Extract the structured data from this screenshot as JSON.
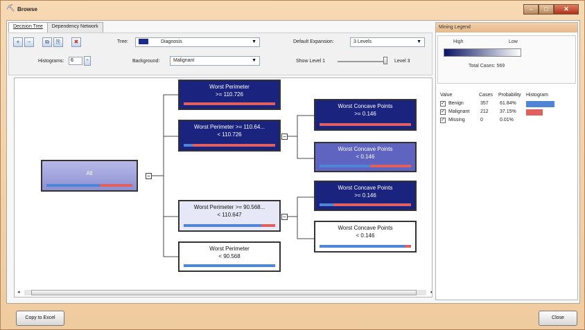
{
  "window": {
    "title": "Browse"
  },
  "tabs": [
    {
      "label": "Decision Tree"
    },
    {
      "label": "Dependency Network"
    }
  ],
  "toolbar": {
    "tree_label": "Tree:",
    "tree_value": "Diagnosis",
    "default_expansion_label": "Default Expansion:",
    "default_expansion_value": "3 Levels",
    "histograms_label": "Histograms:",
    "histograms_value": "6",
    "background_label": "Background:",
    "background_value": "Malignant",
    "show_level_label": "Show Level 1",
    "show_level_end": "Level 3"
  },
  "tree": {
    "colors": {
      "dark": "#1a237e",
      "mid": "#5f64c0",
      "light": "#e7e8f7",
      "benign": "#4f85d6",
      "malignant": "#e0605f"
    },
    "nodes": [
      {
        "id": "all",
        "line1": "All",
        "line2": "",
        "shade": "root",
        "benign": 0.62,
        "malignant": 0.38
      },
      {
        "id": "n1",
        "line1": "Worst Perimeter",
        "line2": ">= 110.726",
        "shade": "dark",
        "benign": 0.0,
        "malignant": 1.0
      },
      {
        "id": "n2",
        "line1": "Worst Perimeter >= 110.64...",
        "line2": "< 110.726",
        "shade": "dark",
        "benign": 0.1,
        "malignant": 0.9
      },
      {
        "id": "n3",
        "line1": "Worst Perimeter >= 90.568...",
        "line2": "< 110.647",
        "shade": "light",
        "benign": 0.85,
        "malignant": 0.15
      },
      {
        "id": "n4",
        "line1": "Worst Perimeter",
        "line2": "< 90.568",
        "shade": "white",
        "benign": 1.0,
        "malignant": 0.0
      },
      {
        "id": "n5",
        "line1": "Worst Concave Points",
        "line2": ">= 0.146",
        "shade": "dark",
        "benign": 0.0,
        "malignant": 1.0
      },
      {
        "id": "n6",
        "line1": "Worst Concave Points",
        "line2": "< 0.146",
        "shade": "mid",
        "benign": 0.55,
        "malignant": 0.45
      },
      {
        "id": "n7",
        "line1": "Worst Concave Points",
        "line2": ">= 0.146",
        "shade": "dark",
        "benign": 0.15,
        "malignant": 0.85
      },
      {
        "id": "n8",
        "line1": "Worst Concave Points",
        "line2": "< 0.146",
        "shade": "white",
        "benign": 0.93,
        "malignant": 0.07
      }
    ]
  },
  "legend": {
    "title": "Mining Legend",
    "high": "High",
    "low": "Low",
    "total_cases": "Total Cases: 569",
    "headers": {
      "value": "Value",
      "cases": "Cases",
      "probability": "Probability",
      "histogram": "Histogram"
    },
    "rows": [
      {
        "value": "Benign",
        "cases": "357",
        "probability": "61.84%",
        "hist_fraction": 0.62,
        "color": "#4f85d6"
      },
      {
        "value": "Malignant",
        "cases": "212",
        "probability": "37.15%",
        "hist_fraction": 0.37,
        "color": "#e0605f"
      },
      {
        "value": "Missing",
        "cases": "0",
        "probability": "0.01%",
        "hist_fraction": 0.0,
        "color": "#999999"
      }
    ]
  },
  "buttons": {
    "copy_to_excel": "Copy to Excel",
    "close": "Close"
  }
}
